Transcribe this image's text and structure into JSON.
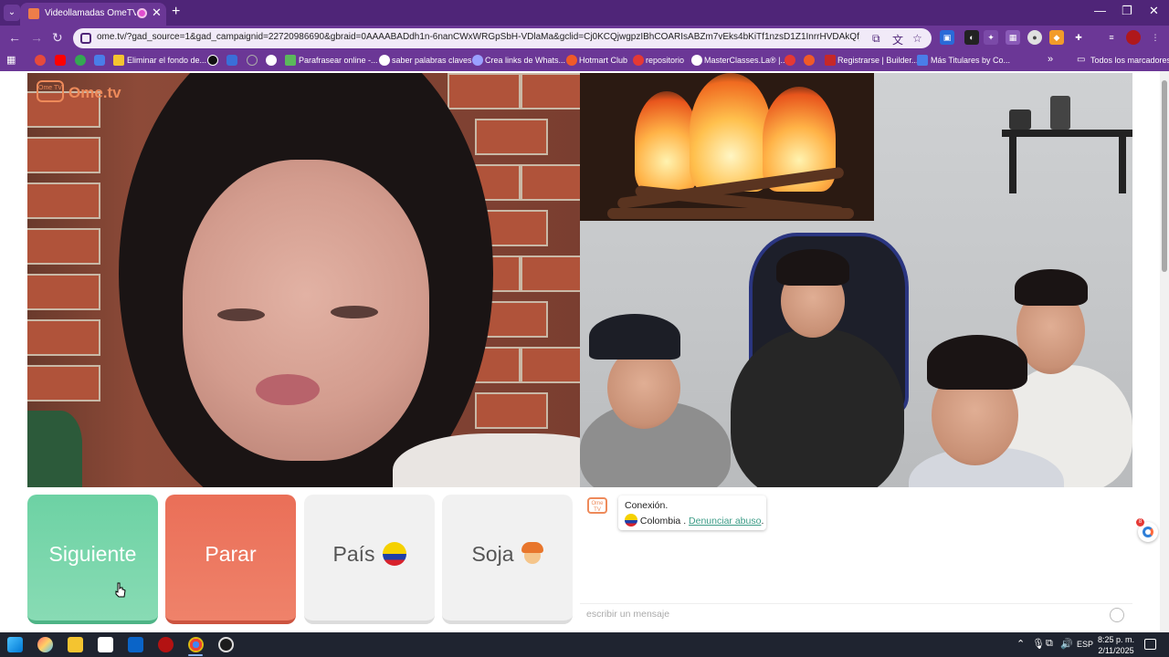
{
  "browser": {
    "tab_title": "Videollamadas OmeTV — A",
    "tab_close": "✕",
    "new_tab": "+",
    "url": "ome.tv/?gad_source=1&gad_campaignid=22720986690&gbraid=0AAAABADdh1n-6nanCWxWRGpSbH-VDlaMa&gclid=Cj0KCQjwgpzIBhCOARIsABZm7vEks4bKiTf1nzsD1Z1InrrHVDAkQf_Z-80nKxCr05Gfy...",
    "window_controls": {
      "minimize": "—",
      "restore": "❐",
      "close": "✕"
    },
    "nav": {
      "back": "←",
      "forward": "→",
      "reload": "↻"
    },
    "bookmarks": [
      {
        "label": "Eliminar el fondo de..."
      },
      {
        "label": "Parafrasear online -..."
      },
      {
        "label": "saber palabras claves"
      },
      {
        "label": "Crea links de Whats..."
      },
      {
        "label": "Hotmart Club"
      },
      {
        "label": "repositorio"
      },
      {
        "label": "MasterClasses.La® |..."
      },
      {
        "label": "Registrarse | Builder..."
      },
      {
        "label": "Más Titulares by Co..."
      }
    ],
    "bookmarks_overflow": "»",
    "all_bookmarks": "Todos los marcadores"
  },
  "page": {
    "logo": "Ome.tv",
    "logo_badge": "Ome TV",
    "controls": {
      "next": "Siguiente",
      "stop": "Parar",
      "country": "País",
      "gender": "Soja"
    },
    "chat": {
      "logo_badge": "Ome TV",
      "status": "Conexión.",
      "country": "Colombia",
      "separator": ".",
      "report_link": "Denunciar abuso",
      "report_suffix": ".",
      "placeholder": "escribir un mensaje"
    },
    "widget_badge": "8"
  },
  "taskbar": {
    "language": "ESP",
    "time": "8:25 p. m.",
    "date": "2/11/2025"
  },
  "colors": {
    "browser_frame": "#4f2578",
    "next_button": "#6dd2a4",
    "stop_button": "#ea6f58",
    "neutral_button": "#f1f1f1",
    "link": "#3b9b86",
    "brand_orange": "#ee8a5a"
  }
}
